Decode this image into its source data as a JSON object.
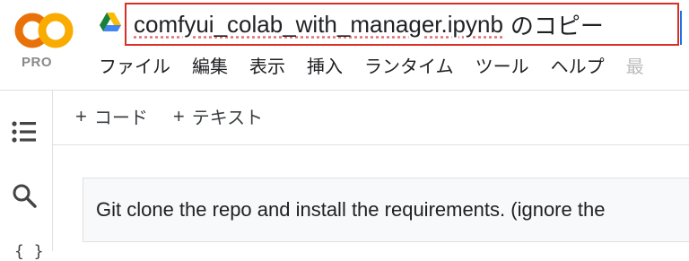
{
  "logo": {
    "text": "CO",
    "badge": "PRO"
  },
  "notebook": {
    "filename": "comfyui_colab_with_manager.ipynb",
    "suffix": "のコピー"
  },
  "menu": [
    "ファイル",
    "編集",
    "表示",
    "挿入",
    "ランタイム",
    "ツール",
    "ヘルプ",
    "最"
  ],
  "toolbar": {
    "add_code": "コード",
    "add_text": "テキスト",
    "plus": "+"
  },
  "rail": {
    "icons": [
      "toc-icon",
      "search-icon",
      "code-snippets-icon"
    ],
    "braces": "{ }"
  },
  "cell": {
    "text": "Git clone the repo and install the requirements. (ignore the"
  },
  "colors": {
    "title_border": "#d93025",
    "logo_orange": "#f9a825",
    "logo_orange_dark": "#e8710a",
    "drive_green": "#188038",
    "drive_yellow": "#fbbc04",
    "drive_blue": "#4285f4"
  }
}
